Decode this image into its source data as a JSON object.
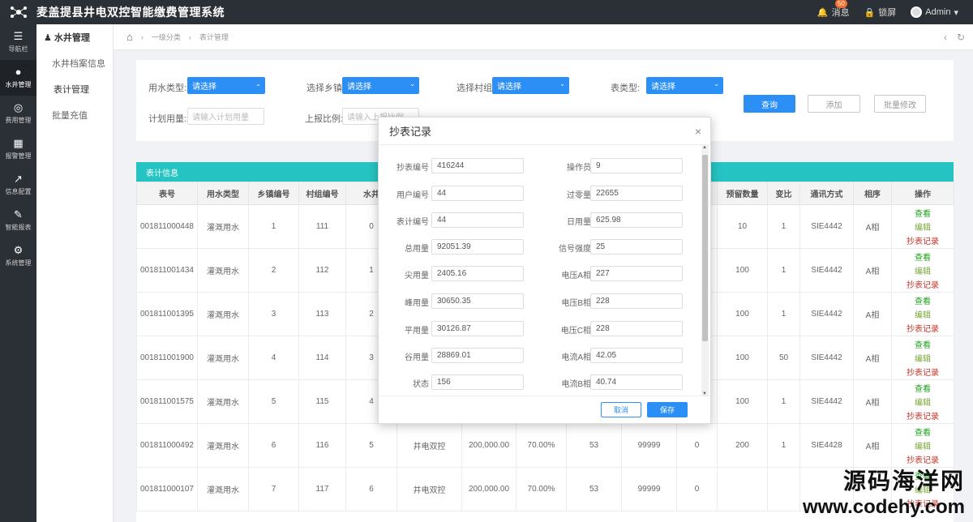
{
  "app": {
    "title": "麦盖提县井电双控智能缴费管理系统"
  },
  "topbar": {
    "messages_label": "消息",
    "messages_count": "50",
    "lock_label": "锁屏",
    "user_label": "Admin"
  },
  "iconbar": {
    "items": [
      {
        "label": "导航栏",
        "icon": "menu-icon"
      },
      {
        "label": "水井管理",
        "icon": "users-icon"
      },
      {
        "label": "费用管理",
        "icon": "compass-icon"
      },
      {
        "label": "报警管理",
        "icon": "calculator-icon"
      },
      {
        "label": "信息配置",
        "icon": "chart-icon"
      },
      {
        "label": "智能报表",
        "icon": "edit-icon"
      },
      {
        "label": "系统管理",
        "icon": "settings-icon"
      }
    ]
  },
  "subnav": {
    "header": "水井管理",
    "items": [
      "水井档案信息",
      "表计管理",
      "批量充值"
    ]
  },
  "breadcrumb": {
    "level1": "一级分类",
    "level2": "表计管理"
  },
  "filter": {
    "water_type_label": "用水类型:",
    "town_label": "选择乡镇:",
    "village_label": "选择村组:",
    "meter_type_label": "表类型:",
    "select_placeholder": "请选择",
    "plan_label": "计划用量:",
    "plan_placeholder": "请输入计划用量",
    "ratio_label": "上报比例:",
    "ratio_placeholder": "请输入上报比例",
    "query_btn": "查询",
    "add_btn": "添加",
    "batch_btn": "批量修改"
  },
  "table": {
    "title": "表计信息",
    "headers": [
      "表号",
      "用水类型",
      "乡镇编号",
      "村组编号",
      "水井",
      "",
      "",
      "",
      "",
      "",
      "",
      "预留数量",
      "变比",
      "通讯方式",
      "相序",
      "操作"
    ],
    "op_labels": {
      "view": "查看",
      "edit": "编辑",
      "record": "抄表记录"
    },
    "rows": [
      [
        "001811000448",
        "灌溉用水",
        "1",
        "111",
        "0",
        "",
        "",
        "",
        "",
        "",
        "",
        "10",
        "1",
        "SIE4442",
        "A相"
      ],
      [
        "001811001434",
        "灌溉用水",
        "2",
        "112",
        "1",
        "",
        "",
        "",
        "",
        "",
        "",
        "100",
        "1",
        "SIE4442",
        "A相"
      ],
      [
        "001811001395",
        "灌溉用水",
        "3",
        "113",
        "2",
        "",
        "",
        "",
        "",
        "",
        "",
        "100",
        "1",
        "SIE4442",
        "A相"
      ],
      [
        "001811001900",
        "灌溉用水",
        "4",
        "114",
        "3",
        "",
        "",
        "",
        "",
        "",
        "",
        "100",
        "50",
        "SIE4442",
        "A相"
      ],
      [
        "001811001575",
        "灌溉用水",
        "5",
        "115",
        "4",
        "",
        "",
        "",
        "",
        "",
        "",
        "100",
        "1",
        "SIE4442",
        "A相"
      ],
      [
        "001811000492",
        "灌溉用水",
        "6",
        "116",
        "5",
        "井电双控",
        "200,000.00",
        "70.00%",
        "53",
        "99999",
        "0",
        "200",
        "1",
        "SIE4428",
        "A相"
      ],
      [
        "001811000107",
        "灌溉用水",
        "7",
        "117",
        "6",
        "井电双控",
        "200,000.00",
        "70.00%",
        "53",
        "99999",
        "0",
        "",
        "",
        "",
        ""
      ]
    ]
  },
  "modal": {
    "title": "抄表记录",
    "left_fields": [
      {
        "label": "抄表编号",
        "value": "416244"
      },
      {
        "label": "用户编号",
        "value": "44"
      },
      {
        "label": "表计编号",
        "value": "44"
      },
      {
        "label": "总用量",
        "value": "92051.39"
      },
      {
        "label": "尖用量",
        "value": "2405.16"
      },
      {
        "label": "峰用量",
        "value": "30650.35"
      },
      {
        "label": "平用量",
        "value": "30126.87"
      },
      {
        "label": "谷用量",
        "value": "28869.01"
      },
      {
        "label": "状态",
        "value": "156"
      }
    ],
    "right_fields": [
      {
        "label": "操作员",
        "value": "9"
      },
      {
        "label": "过零量",
        "value": "22655"
      },
      {
        "label": "日用量",
        "value": "625.98"
      },
      {
        "label": "信号强度",
        "value": "25"
      },
      {
        "label": "电压A相",
        "value": "227"
      },
      {
        "label": "电压B相",
        "value": "228"
      },
      {
        "label": "电压C相",
        "value": "228"
      },
      {
        "label": "电流A相",
        "value": "42.05"
      },
      {
        "label": "电流B相",
        "value": "40.74"
      }
    ],
    "cancel": "取消",
    "save": "保存"
  },
  "watermark": {
    "cn": "源码海洋网",
    "en": "www.codehy.com"
  },
  "colors": {
    "accent": "#2b8ff5",
    "teal": "#25c4c2",
    "dark": "#2b2f36"
  }
}
